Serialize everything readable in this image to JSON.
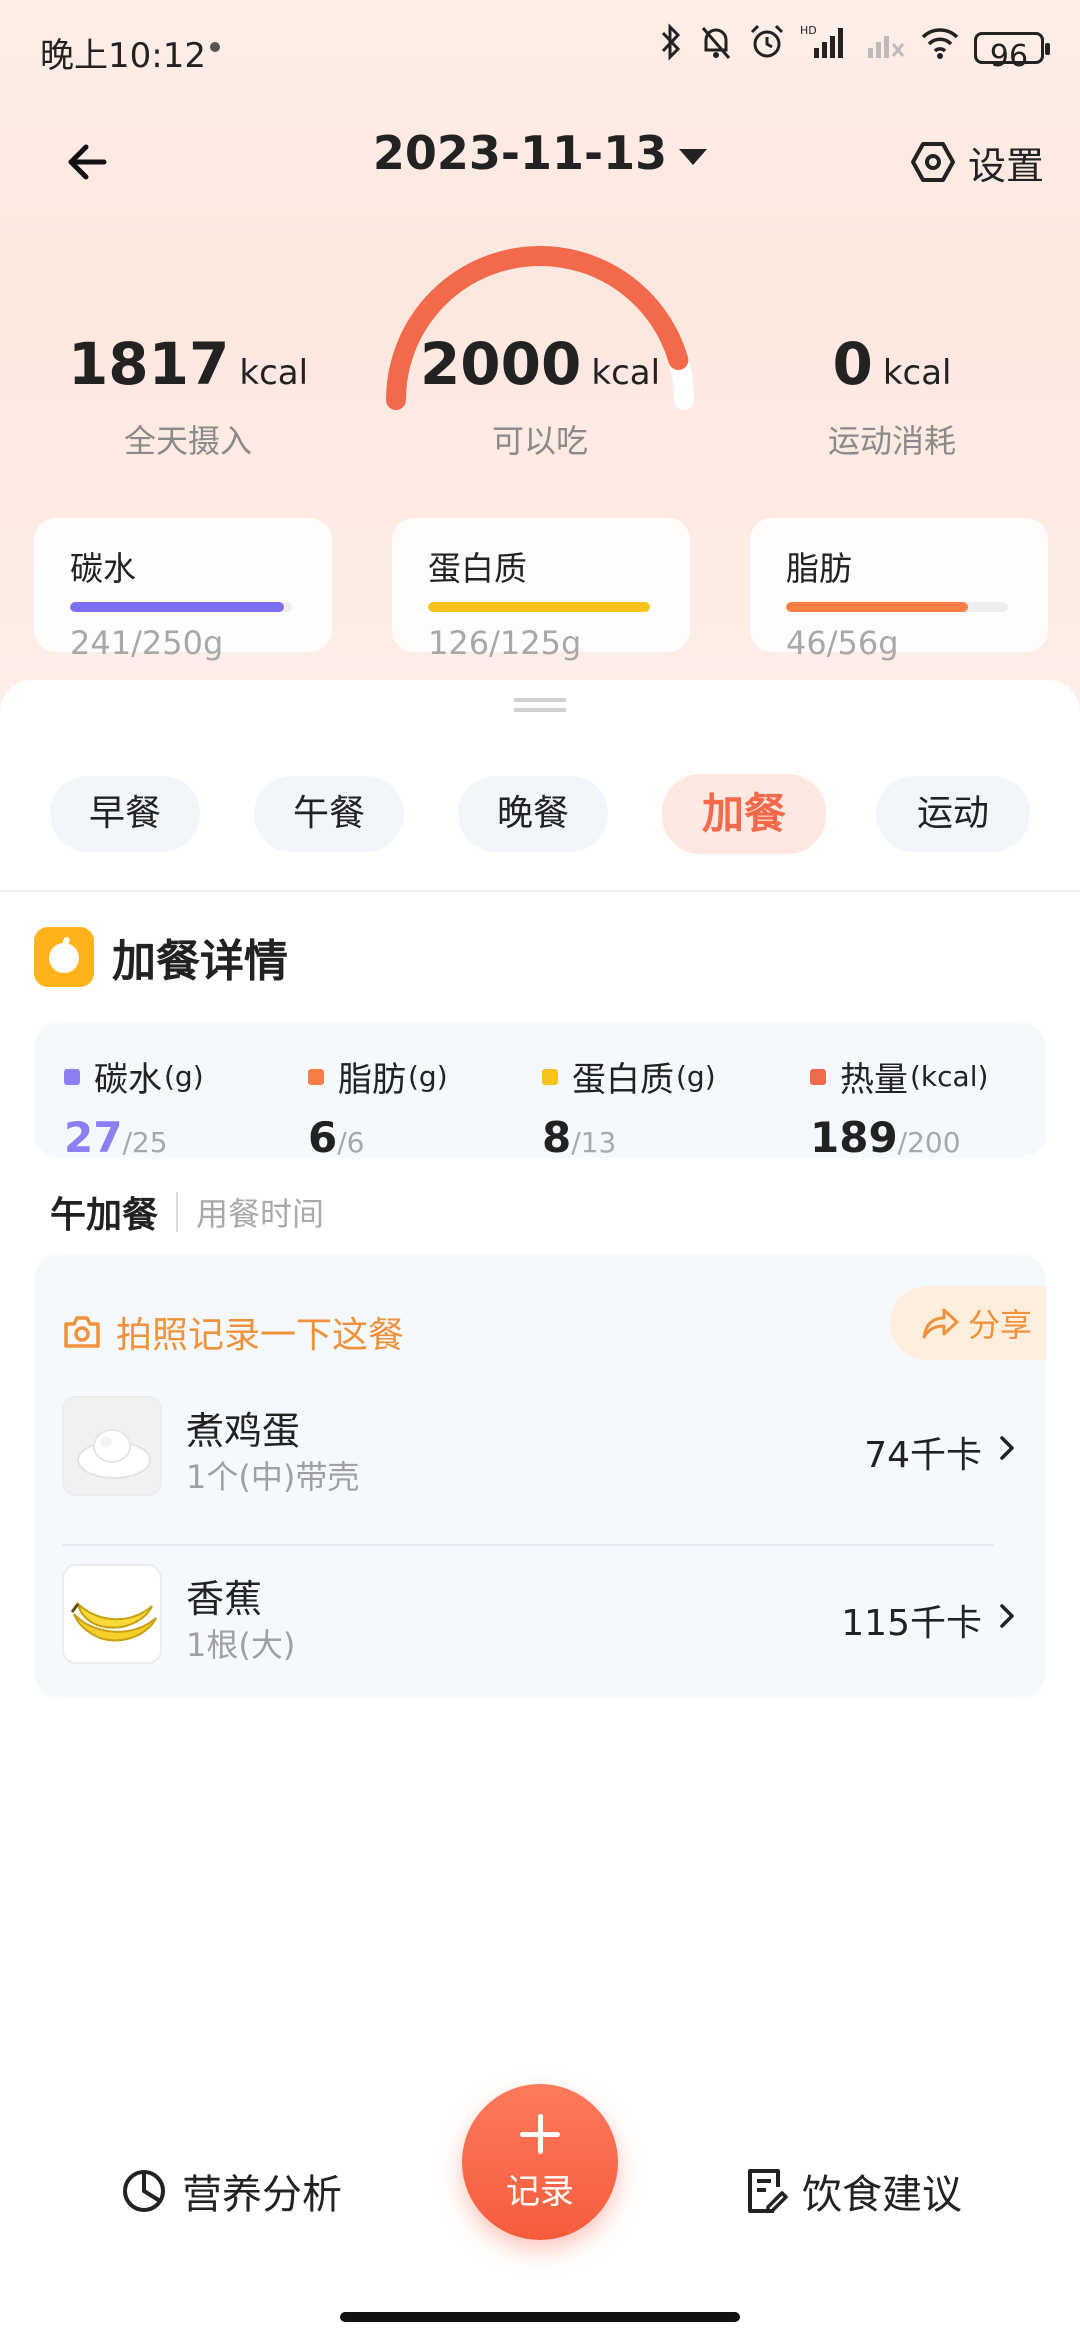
{
  "status_bar": {
    "time": "晚上10:12",
    "network_label": "HD",
    "battery": "96"
  },
  "header": {
    "date": "2023-11-13",
    "settings_label": "设置"
  },
  "summary": {
    "intake": {
      "value": "1817",
      "unit": "kcal",
      "label": "全天摄入"
    },
    "available": {
      "value": "2000",
      "unit": "kcal",
      "label": "可以吃"
    },
    "exercise": {
      "value": "0",
      "unit": "kcal",
      "label": "运动消耗"
    },
    "arc_progress": 0.91
  },
  "macros": [
    {
      "name": "碳水",
      "value": "241/250g",
      "progress": 0.964,
      "color": "#7d6ff0"
    },
    {
      "name": "蛋白质",
      "value": "126/125g",
      "progress": 1.0,
      "color": "#f7c21c"
    },
    {
      "name": "脂肪",
      "value": "46/56g",
      "progress": 0.82,
      "color": "#f77f45"
    }
  ],
  "tabs": [
    {
      "label": "早餐",
      "active": false
    },
    {
      "label": "午餐",
      "active": false
    },
    {
      "label": "晚餐",
      "active": false
    },
    {
      "label": "加餐",
      "active": true
    },
    {
      "label": "运动",
      "active": false
    }
  ],
  "detail": {
    "title": "加餐详情",
    "nutrients": [
      {
        "label": "碳水",
        "unit": "(g)",
        "value": "27",
        "target": "/25",
        "color": "#8b7ff2",
        "value_color": "#8b7ff2"
      },
      {
        "label": "脂肪",
        "unit": "(g)",
        "value": "6",
        "target": "/6",
        "color": "#f77f45",
        "value_color": "#222222"
      },
      {
        "label": "蛋白质",
        "unit": "(g)",
        "value": "8",
        "target": "/13",
        "color": "#f7c21c",
        "value_color": "#222222"
      },
      {
        "label": "热量",
        "unit": "(kcal)",
        "value": "189",
        "target": "/200",
        "color": "#f26a4b",
        "value_color": "#222222"
      }
    ]
  },
  "meal": {
    "name": "午加餐",
    "time_placeholder": "用餐时间",
    "photo_prompt": "拍照记录一下这餐",
    "share_label": "分享",
    "foods": [
      {
        "name": "煮鸡蛋",
        "desc": "1个(中)带壳",
        "kcal": "74千卡",
        "thumb": "boiled-egg"
      },
      {
        "name": "香蕉",
        "desc": "1根(大)",
        "kcal": "115千卡",
        "thumb": "banana"
      }
    ]
  },
  "bottom_nav": {
    "analysis_label": "营养分析",
    "record_label": "记录",
    "advice_label": "饮食建议"
  }
}
